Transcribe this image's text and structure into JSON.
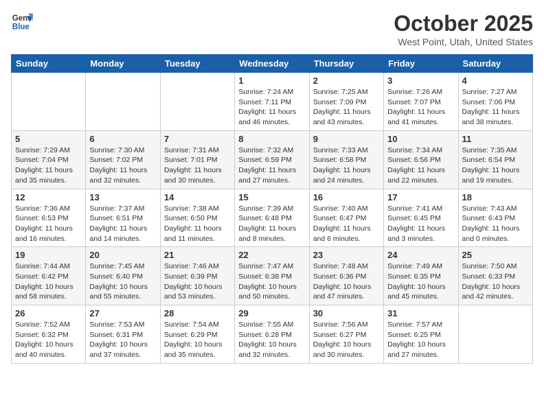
{
  "header": {
    "logo_general": "General",
    "logo_blue": "Blue",
    "month_title": "October 2025",
    "location": "West Point, Utah, United States"
  },
  "days_of_week": [
    "Sunday",
    "Monday",
    "Tuesday",
    "Wednesday",
    "Thursday",
    "Friday",
    "Saturday"
  ],
  "weeks": [
    [
      {
        "day": "",
        "info": ""
      },
      {
        "day": "",
        "info": ""
      },
      {
        "day": "",
        "info": ""
      },
      {
        "day": "1",
        "info": "Sunrise: 7:24 AM\nSunset: 7:11 PM\nDaylight: 11 hours\nand 46 minutes."
      },
      {
        "day": "2",
        "info": "Sunrise: 7:25 AM\nSunset: 7:09 PM\nDaylight: 11 hours\nand 43 minutes."
      },
      {
        "day": "3",
        "info": "Sunrise: 7:26 AM\nSunset: 7:07 PM\nDaylight: 11 hours\nand 41 minutes."
      },
      {
        "day": "4",
        "info": "Sunrise: 7:27 AM\nSunset: 7:06 PM\nDaylight: 11 hours\nand 38 minutes."
      }
    ],
    [
      {
        "day": "5",
        "info": "Sunrise: 7:29 AM\nSunset: 7:04 PM\nDaylight: 11 hours\nand 35 minutes."
      },
      {
        "day": "6",
        "info": "Sunrise: 7:30 AM\nSunset: 7:02 PM\nDaylight: 11 hours\nand 32 minutes."
      },
      {
        "day": "7",
        "info": "Sunrise: 7:31 AM\nSunset: 7:01 PM\nDaylight: 11 hours\nand 30 minutes."
      },
      {
        "day": "8",
        "info": "Sunrise: 7:32 AM\nSunset: 6:59 PM\nDaylight: 11 hours\nand 27 minutes."
      },
      {
        "day": "9",
        "info": "Sunrise: 7:33 AM\nSunset: 6:58 PM\nDaylight: 11 hours\nand 24 minutes."
      },
      {
        "day": "10",
        "info": "Sunrise: 7:34 AM\nSunset: 6:56 PM\nDaylight: 11 hours\nand 22 minutes."
      },
      {
        "day": "11",
        "info": "Sunrise: 7:35 AM\nSunset: 6:54 PM\nDaylight: 11 hours\nand 19 minutes."
      }
    ],
    [
      {
        "day": "12",
        "info": "Sunrise: 7:36 AM\nSunset: 6:53 PM\nDaylight: 11 hours\nand 16 minutes."
      },
      {
        "day": "13",
        "info": "Sunrise: 7:37 AM\nSunset: 6:51 PM\nDaylight: 11 hours\nand 14 minutes."
      },
      {
        "day": "14",
        "info": "Sunrise: 7:38 AM\nSunset: 6:50 PM\nDaylight: 11 hours\nand 11 minutes."
      },
      {
        "day": "15",
        "info": "Sunrise: 7:39 AM\nSunset: 6:48 PM\nDaylight: 11 hours\nand 8 minutes."
      },
      {
        "day": "16",
        "info": "Sunrise: 7:40 AM\nSunset: 6:47 PM\nDaylight: 11 hours\nand 6 minutes."
      },
      {
        "day": "17",
        "info": "Sunrise: 7:41 AM\nSunset: 6:45 PM\nDaylight: 11 hours\nand 3 minutes."
      },
      {
        "day": "18",
        "info": "Sunrise: 7:43 AM\nSunset: 6:43 PM\nDaylight: 11 hours\nand 0 minutes."
      }
    ],
    [
      {
        "day": "19",
        "info": "Sunrise: 7:44 AM\nSunset: 6:42 PM\nDaylight: 10 hours\nand 58 minutes."
      },
      {
        "day": "20",
        "info": "Sunrise: 7:45 AM\nSunset: 6:40 PM\nDaylight: 10 hours\nand 55 minutes."
      },
      {
        "day": "21",
        "info": "Sunrise: 7:46 AM\nSunset: 6:39 PM\nDaylight: 10 hours\nand 53 minutes."
      },
      {
        "day": "22",
        "info": "Sunrise: 7:47 AM\nSunset: 6:38 PM\nDaylight: 10 hours\nand 50 minutes."
      },
      {
        "day": "23",
        "info": "Sunrise: 7:48 AM\nSunset: 6:36 PM\nDaylight: 10 hours\nand 47 minutes."
      },
      {
        "day": "24",
        "info": "Sunrise: 7:49 AM\nSunset: 6:35 PM\nDaylight: 10 hours\nand 45 minutes."
      },
      {
        "day": "25",
        "info": "Sunrise: 7:50 AM\nSunset: 6:33 PM\nDaylight: 10 hours\nand 42 minutes."
      }
    ],
    [
      {
        "day": "26",
        "info": "Sunrise: 7:52 AM\nSunset: 6:32 PM\nDaylight: 10 hours\nand 40 minutes."
      },
      {
        "day": "27",
        "info": "Sunrise: 7:53 AM\nSunset: 6:31 PM\nDaylight: 10 hours\nand 37 minutes."
      },
      {
        "day": "28",
        "info": "Sunrise: 7:54 AM\nSunset: 6:29 PM\nDaylight: 10 hours\nand 35 minutes."
      },
      {
        "day": "29",
        "info": "Sunrise: 7:55 AM\nSunset: 6:28 PM\nDaylight: 10 hours\nand 32 minutes."
      },
      {
        "day": "30",
        "info": "Sunrise: 7:56 AM\nSunset: 6:27 PM\nDaylight: 10 hours\nand 30 minutes."
      },
      {
        "day": "31",
        "info": "Sunrise: 7:57 AM\nSunset: 6:25 PM\nDaylight: 10 hours\nand 27 minutes."
      },
      {
        "day": "",
        "info": ""
      }
    ]
  ]
}
